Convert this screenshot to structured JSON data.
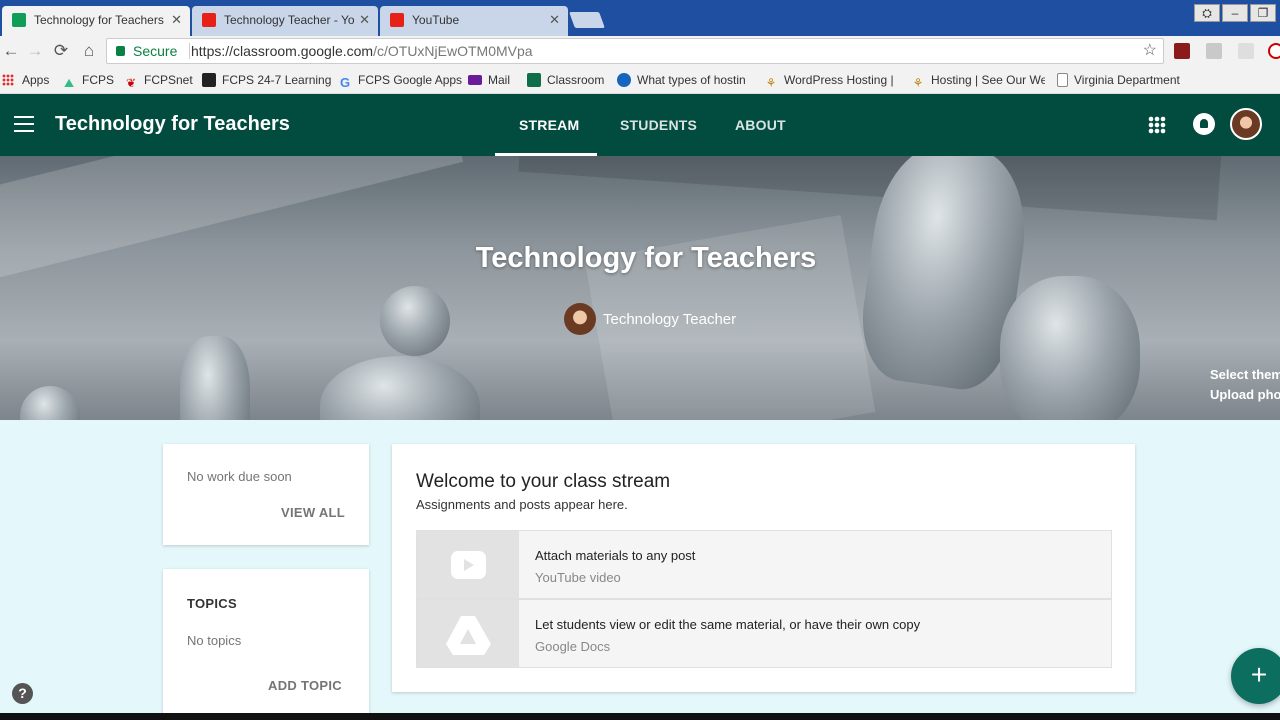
{
  "browser": {
    "tabs": [
      {
        "title": "Technology for Teachers",
        "icon": "classroom-icon",
        "color": "#0f9d58"
      },
      {
        "title": "Technology Teacher - Yo",
        "icon": "youtube-icon",
        "color": "#e62117"
      },
      {
        "title": "YouTube",
        "icon": "youtube-icon",
        "color": "#e62117"
      }
    ],
    "secure_label": "Secure",
    "url_host": "https://classroom.google.com",
    "url_path": "/c/OTUxNjEwOTM0MVpa",
    "bookmarks": [
      {
        "label": "Apps",
        "icon": "apps-grid-icon"
      },
      {
        "label": "FCPS",
        "icon": "fcps-icon"
      },
      {
        "label": "FCPSnet",
        "icon": "fcpsnet-icon"
      },
      {
        "label": "FCPS 24-7 Learning",
        "icon": "blackboard-icon"
      },
      {
        "label": "FCPS Google Apps",
        "icon": "google-icon"
      },
      {
        "label": "Mail",
        "icon": "mail-icon"
      },
      {
        "label": "Classroom",
        "icon": "classroom-icon"
      },
      {
        "label": "What types of hostin",
        "icon": "globe-icon"
      },
      {
        "label": "WordPress Hosting |",
        "icon": "hosting-icon"
      },
      {
        "label": "Hosting | See Our We",
        "icon": "hosting-icon"
      },
      {
        "label": "Virginia Department",
        "icon": "page-icon"
      }
    ]
  },
  "app": {
    "class_name": "Technology for Teachers",
    "nav": [
      "STREAM",
      "STUDENTS",
      "ABOUT"
    ],
    "active_nav": "STREAM",
    "brand_color": "#024c3f"
  },
  "banner": {
    "title": "Technology for Teachers",
    "teacher": "Technology Teacher",
    "select_theme": "Select theme",
    "upload_photo": "Upload photo"
  },
  "upcoming": {
    "status": "No work due soon",
    "view_all": "VIEW ALL"
  },
  "topics": {
    "heading": "TOPICS",
    "status": "No topics",
    "add": "ADD TOPIC"
  },
  "stream": {
    "title": "Welcome to your class stream",
    "subtitle": "Assignments and posts appear here.",
    "tips": [
      {
        "text": "Attach materials to any post",
        "sub": "YouTube video",
        "icon": "youtube-play-icon"
      },
      {
        "text": "Let students view or edit the same material, or have their own copy",
        "sub": "Google Docs",
        "icon": "google-drive-icon"
      }
    ]
  },
  "fab_label": "+",
  "help_label": "?"
}
